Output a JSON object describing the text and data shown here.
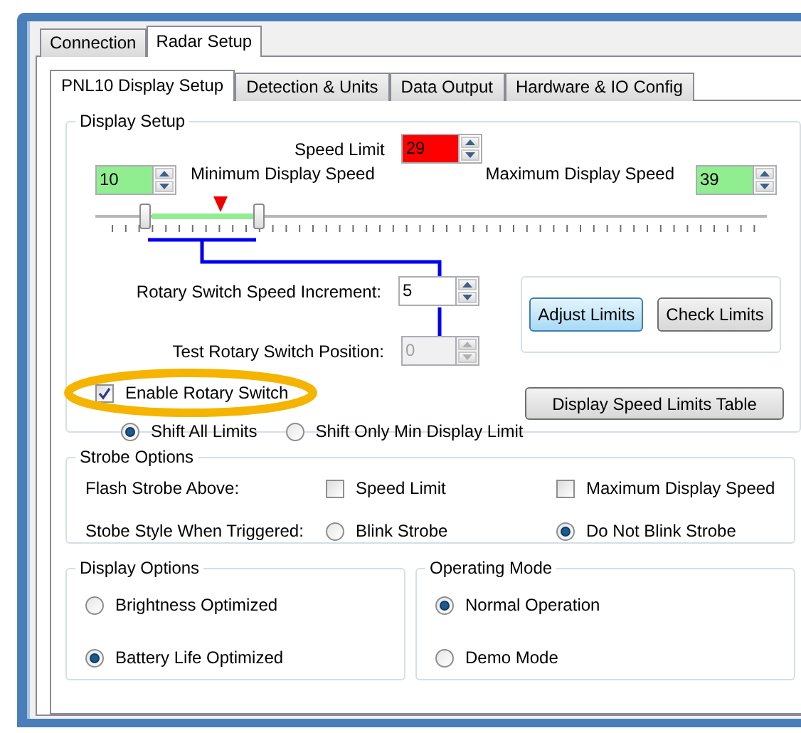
{
  "tabs": [
    {
      "label": "Connection",
      "selected": false
    },
    {
      "label": "Radar Setup",
      "selected": true
    }
  ],
  "subtabs": [
    {
      "label": "PNL10 Display Setup",
      "selected": true
    },
    {
      "label": "Detection & Units",
      "selected": false
    },
    {
      "label": "Data Output",
      "selected": false
    },
    {
      "label": "Hardware & IO Config",
      "selected": false
    }
  ],
  "display_setup": {
    "title": "Display Setup",
    "speed_limit": {
      "label": "Speed Limit",
      "value": "29",
      "color": "#ff0000"
    },
    "min_speed": {
      "label": "Minimum Display Speed",
      "value": "10",
      "color": "#90ee90"
    },
    "max_speed": {
      "label": "Maximum Display Speed",
      "value": "39",
      "color": "#90ee90"
    },
    "range_slider": {
      "thumbs": [
        {
          "level": 0.074
        },
        {
          "level": 0.244
        }
      ],
      "marker": {
        "level": 0.186
      }
    },
    "rotary_increment": {
      "label": "Rotary Switch Speed Increment:",
      "value": "5",
      "disabled": false
    },
    "rotary_test": {
      "label": "Test Rotary Switch Position:",
      "value": "0",
      "disabled": true
    },
    "limit_buttons": [
      {
        "label": "Adjust Limits",
        "selected": true
      },
      {
        "label": "Check Limits",
        "selected": false
      }
    ],
    "enable_rotary": {
      "label": "Enable Rotary Switch",
      "checked": true
    },
    "shift_modes": [
      {
        "label": "Shift All Limits",
        "selected": true
      },
      {
        "label": "Shift Only Min Display Limit",
        "selected": false
      }
    ],
    "table_button": "Display Speed Limits Table"
  },
  "strobe_options": {
    "title": "Strobe Options",
    "flash_label": "Flash Strobe Above:",
    "flash_checks": [
      {
        "label": "Speed Limit",
        "checked": false
      },
      {
        "label": "Maximum Display Speed",
        "checked": false
      }
    ],
    "style_label": "Stobe Style When Triggered:",
    "styles": [
      {
        "label": "Blink Strobe",
        "selected": false
      },
      {
        "label": "Do Not Blink Strobe",
        "selected": true
      }
    ]
  },
  "display_options": {
    "title": "Display Options",
    "options": [
      {
        "label": "Brightness Optimized",
        "selected": false
      },
      {
        "label": "Battery Life Optimized",
        "selected": true
      }
    ]
  },
  "operating_mode": {
    "title": "Operating Mode",
    "options": [
      {
        "label": "Normal Operation",
        "selected": true
      },
      {
        "label": "Demo Mode",
        "selected": false
      }
    ]
  }
}
